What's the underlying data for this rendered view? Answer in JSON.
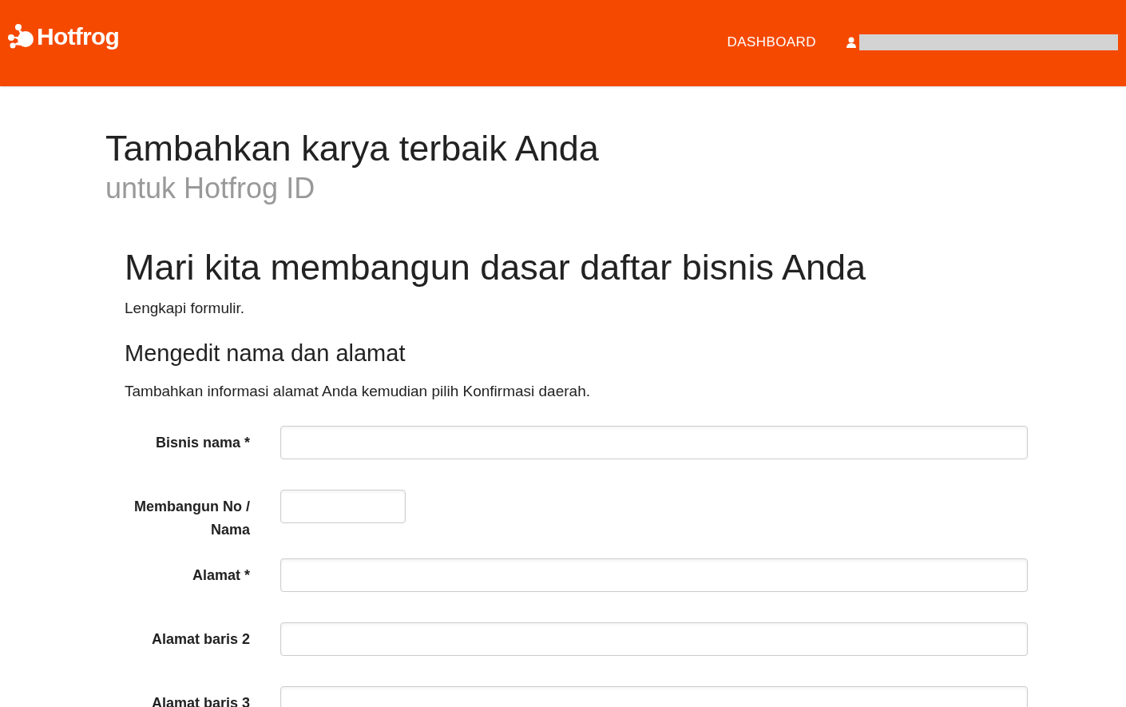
{
  "header": {
    "logo": "Hotfrog",
    "nav": [
      {
        "label": "DASHBOARD"
      }
    ],
    "account": {
      "redacted": true
    }
  },
  "page_title": "Tambahkan karya terbaik Anda",
  "page_subtitle": "untuk Hotfrog ID",
  "form": {
    "title": "Mari kita membangun dasar daftar bisnis Anda",
    "intro": "Lengkapi formulir.",
    "section_title": "Mengedit nama dan alamat",
    "section_text": "Tambahkan informasi alamat Anda kemudian pilih Konfirmasi daerah.",
    "fields": [
      {
        "label": "Bisnis nama *",
        "kind": "wide"
      },
      {
        "label": "Membangun No / Nama",
        "kind": "short"
      },
      {
        "label": "Alamat *",
        "kind": "wide"
      },
      {
        "label": "Alamat baris 2",
        "kind": "wide"
      },
      {
        "label": "Alamat baris 3",
        "kind": "wide"
      }
    ]
  }
}
